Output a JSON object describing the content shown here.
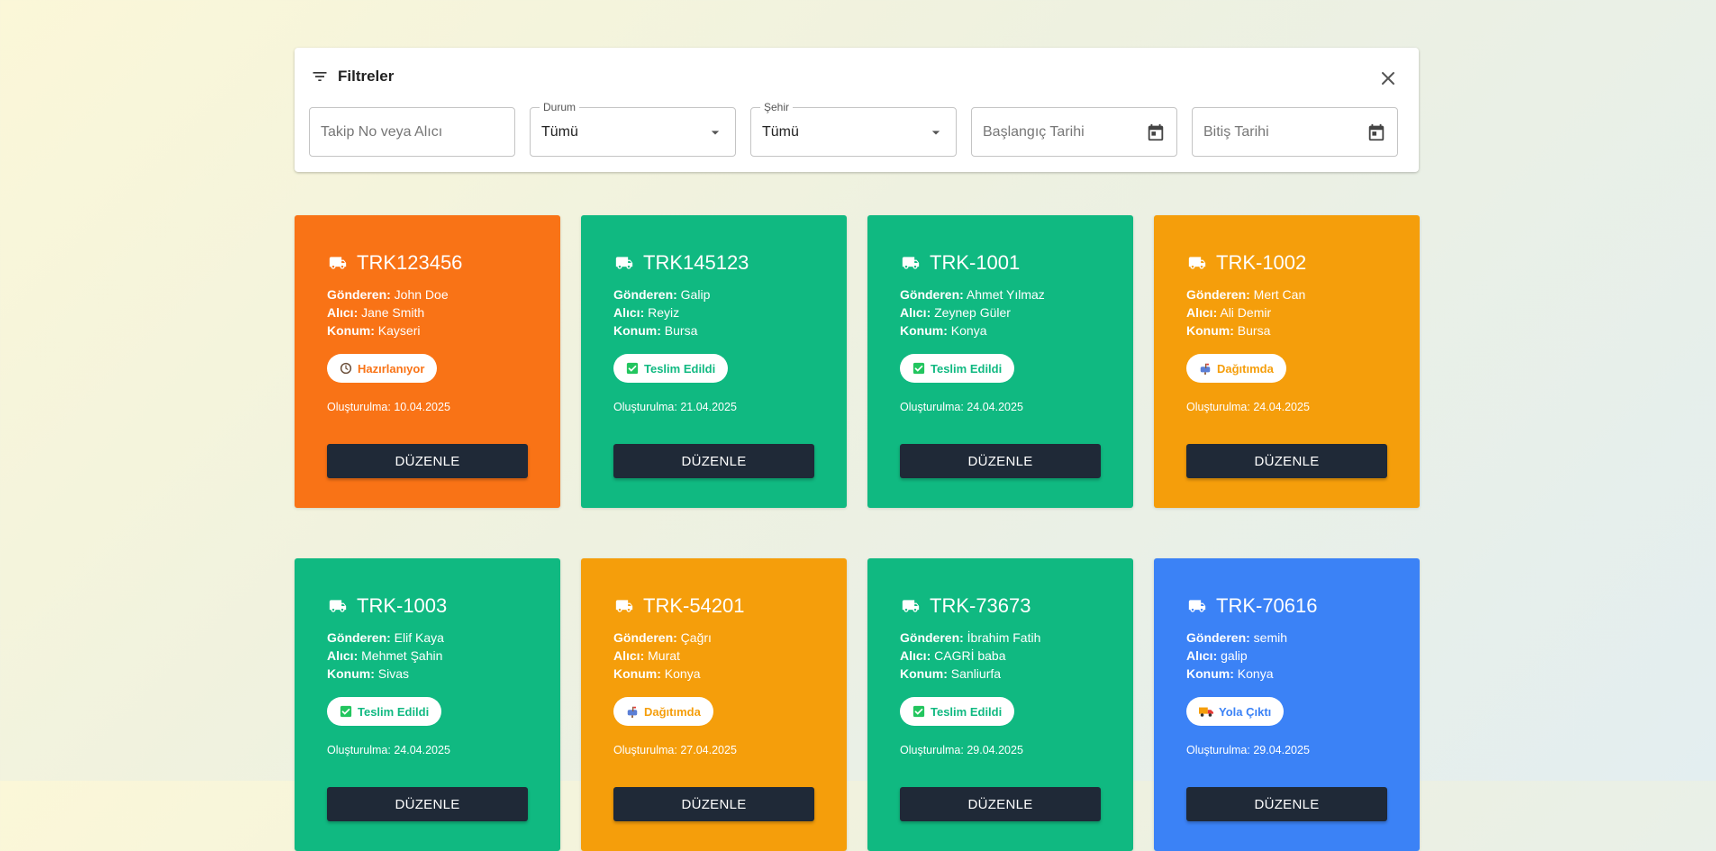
{
  "filters": {
    "title": "Filtreler",
    "search_placeholder": "Takip No veya Alıcı",
    "status_label": "Durum",
    "status_value": "Tümü",
    "city_label": "Şehir",
    "city_value": "Tümü",
    "start_date_placeholder": "Başlangıç Tarihi",
    "end_date_placeholder": "Bitiş Tarihi"
  },
  "labels": {
    "sender": "Gönderen:",
    "receiver": "Alıcı:",
    "location": "Konum:",
    "created": "Oluşturulma:",
    "edit": "DÜZENLE"
  },
  "colors": {
    "orange_red": "#f97316",
    "green": "#10b981",
    "amber": "#f59e0b",
    "blue": "#3b82f6",
    "button": "#1f2937"
  },
  "shipments": [
    {
      "id": "TRK123456",
      "sender": "John Doe",
      "receiver": "Jane Smith",
      "location": "Kayseri",
      "status": "Hazırlanıyor",
      "status_icon": "clock-icon",
      "created": "10.04.2025",
      "color": "#f97316",
      "status_color": "#f97316"
    },
    {
      "id": "TRK145123",
      "sender": "Galip",
      "receiver": "Reyiz",
      "location": "Bursa",
      "status": "Teslim Edildi",
      "status_icon": "check-box-icon",
      "created": "21.04.2025",
      "color": "#10b981",
      "status_color": "#10b981"
    },
    {
      "id": "TRK-1001",
      "sender": "Ahmet Yılmaz",
      "receiver": "Zeynep Güler",
      "location": "Konya",
      "status": "Teslim Edildi",
      "status_icon": "check-box-icon",
      "created": "24.04.2025",
      "color": "#10b981",
      "status_color": "#10b981"
    },
    {
      "id": "TRK-1002",
      "sender": "Mert Can",
      "receiver": "Ali Demir",
      "location": "Bursa",
      "status": "Dağıtımda",
      "status_icon": "mailbox-icon",
      "created": "24.04.2025",
      "color": "#f59e0b",
      "status_color": "#f59e0b"
    },
    {
      "id": "TRK-1003",
      "sender": "Elif Kaya",
      "receiver": "Mehmet Şahin",
      "location": "Sivas",
      "status": "Teslim Edildi",
      "status_icon": "check-box-icon",
      "created": "24.04.2025",
      "color": "#10b981",
      "status_color": "#10b981"
    },
    {
      "id": "TRK-54201",
      "sender": "Çağrı",
      "receiver": "Murat",
      "location": "Konya",
      "status": "Dağıtımda",
      "status_icon": "mailbox-icon",
      "created": "27.04.2025",
      "color": "#f59e0b",
      "status_color": "#f59e0b"
    },
    {
      "id": "TRK-73673",
      "sender": "İbrahim Fatih",
      "receiver": "CAGRİ baba",
      "location": "Sanliurfa",
      "status": "Teslim Edildi",
      "status_icon": "check-box-icon",
      "created": "29.04.2025",
      "color": "#10b981",
      "status_color": "#10b981"
    },
    {
      "id": "TRK-70616",
      "sender": "semih",
      "receiver": "galip",
      "location": "Konya",
      "status": "Yola Çıktı",
      "status_icon": "delivery-truck-icon",
      "created": "29.04.2025",
      "color": "#3b82f6",
      "status_color": "#3b82f6"
    }
  ]
}
